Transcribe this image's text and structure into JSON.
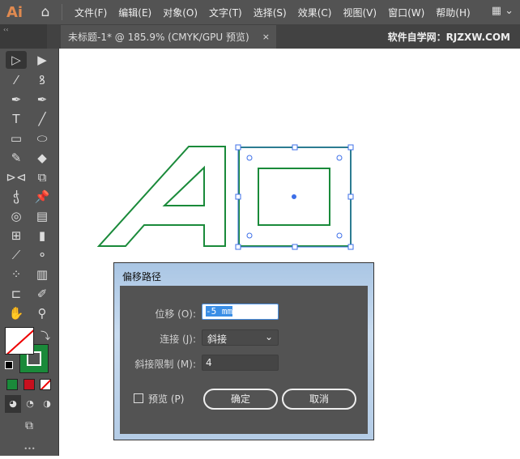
{
  "app": {
    "logo": "Ai",
    "home_icon": "home-icon"
  },
  "menu": [
    "文件(F)",
    "编辑(E)",
    "对象(O)",
    "文字(T)",
    "选择(S)",
    "效果(C)",
    "视图(V)",
    "窗口(W)",
    "帮助(H)"
  ],
  "panel_collapse": "‹‹",
  "tab": {
    "title": "未标题-1* @ 185.9% (CMYK/GPU 预览)",
    "close": "×"
  },
  "watermark": "软件自学网：RJZXW.COM",
  "colors": {
    "stroke": "#1a8a3a",
    "fill_none": "#ffffff",
    "selection": "#3d6fe8",
    "swatch_red": "#c8101e"
  },
  "dialog": {
    "title": "偏移路径",
    "offset_label": "位移 (O):",
    "offset_value": "-5 mm",
    "joins_label": "连接 (J):",
    "joins_value": "斜接",
    "miter_label": "斜接限制 (M):",
    "miter_value": "4",
    "preview_label": "预览 (P)",
    "preview_checked": false,
    "ok": "确定",
    "cancel": "取消"
  },
  "more": "•••"
}
